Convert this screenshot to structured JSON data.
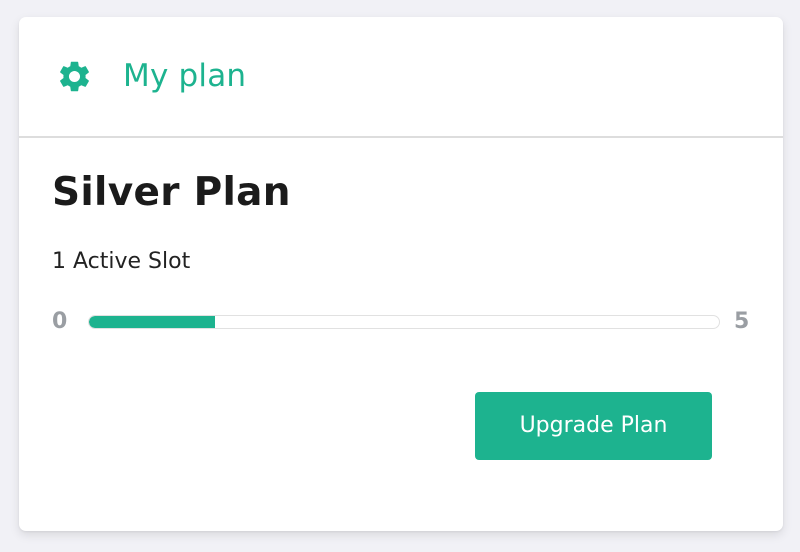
{
  "header": {
    "icon": "gear-icon",
    "title": "My plan"
  },
  "plan": {
    "name": "Silver Plan",
    "active_slots_text": "1 Active Slot",
    "usage": {
      "min_label": "0",
      "max_label": "5",
      "value": 1,
      "max": 5
    },
    "upgrade_label": "Upgrade Plan"
  },
  "colors": {
    "accent": "#1db38f",
    "text_dark": "#1b1b1b",
    "muted": "#9a9ea3",
    "background": "#f1f1f6"
  }
}
